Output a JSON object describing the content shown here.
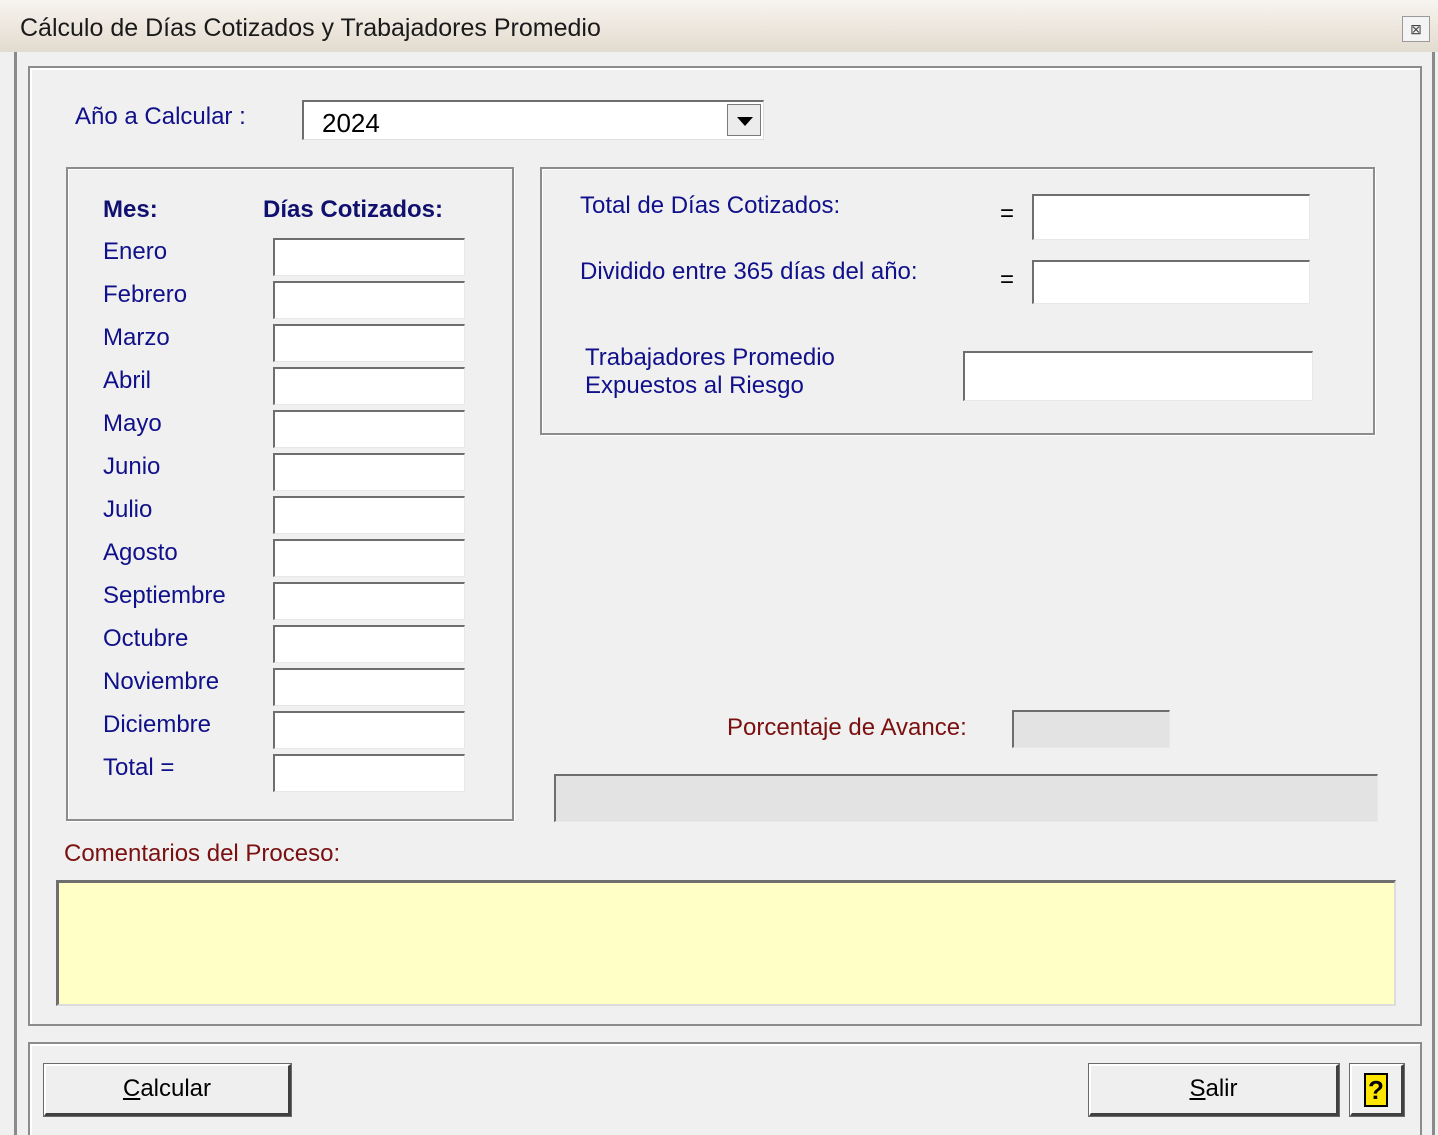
{
  "window": {
    "title": "Cálculo de Días Cotizados y Trabajadores Promedio",
    "close_glyph": "⊠"
  },
  "year": {
    "label": "Año a Calcular :",
    "value": "2024"
  },
  "months_group": {
    "header_month": "Mes:",
    "header_days": "Días Cotizados:",
    "rows": [
      {
        "label": "Enero",
        "value": ""
      },
      {
        "label": "Febrero",
        "value": ""
      },
      {
        "label": "Marzo",
        "value": ""
      },
      {
        "label": "Abril",
        "value": ""
      },
      {
        "label": "Mayo",
        "value": ""
      },
      {
        "label": "Junio",
        "value": ""
      },
      {
        "label": "Julio",
        "value": ""
      },
      {
        "label": "Agosto",
        "value": ""
      },
      {
        "label": "Septiembre",
        "value": ""
      },
      {
        "label": "Octubre",
        "value": ""
      },
      {
        "label": "Noviembre",
        "value": ""
      },
      {
        "label": "Diciembre",
        "value": ""
      },
      {
        "label": "Total =",
        "value": ""
      }
    ]
  },
  "results": {
    "total_label": "Total de Días Cotizados:",
    "total_eq": "=",
    "total_value": "",
    "divided_label": "Dividido entre 365 días del año:",
    "divided_eq": "=",
    "divided_value": "",
    "workers_label_line1": "Trabajadores Promedio",
    "workers_label_line2": "Expuestos al Riesgo",
    "workers_value": ""
  },
  "progress": {
    "label": "Porcentaje de Avance:",
    "value": "",
    "fraction": 0
  },
  "comments": {
    "label": "Comentarios del Proceso:",
    "value": ""
  },
  "buttons": {
    "calcular": "Calcular",
    "salir": "Salir",
    "help": "?"
  }
}
